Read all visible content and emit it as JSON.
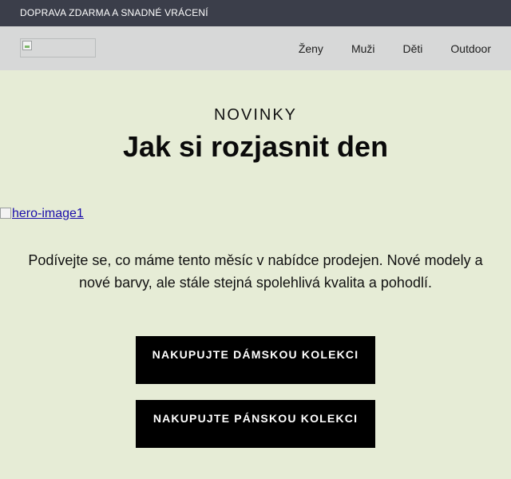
{
  "topbar": {
    "text": "DOPRAVA ZDARMA A SNADNÉ VRÁCENÍ"
  },
  "nav": {
    "items": [
      {
        "label": "Ženy"
      },
      {
        "label": "Muži"
      },
      {
        "label": "Děti"
      },
      {
        "label": "Outdoor"
      }
    ]
  },
  "hero": {
    "eyebrow": "NOVINKY",
    "headline": "Jak si rozjasnit den",
    "image_alt": "hero-image1",
    "intro": "Podívejte se, co máme tento měsíc v nabídce prodejen. Nové modely a nové barvy, ale stále stejná spolehlivá kvalita a pohodlí."
  },
  "cta": {
    "women": "NAKUPUJTE DÁMSKOU KOLEKCI",
    "men": "NAKUPUJTE PÁNSKOU KOLEKCI"
  },
  "colors": {
    "topbar_bg": "#3b3e4a",
    "navbar_bg": "#d7d8d8",
    "page_bg": "#e6ecd6",
    "button_bg": "#000000"
  }
}
